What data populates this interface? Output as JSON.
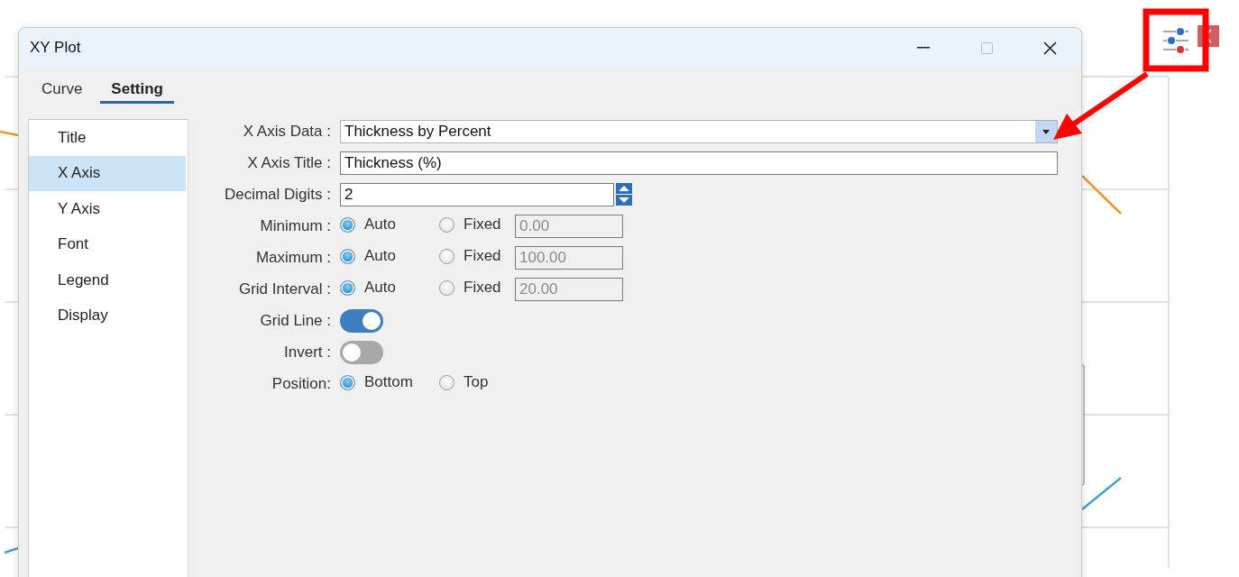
{
  "window": {
    "title": "XY Plot"
  },
  "tabs": [
    {
      "label": "Curve",
      "selected": false
    },
    {
      "label": "Setting",
      "selected": true
    }
  ],
  "sidebar": {
    "items": [
      {
        "label": "Title",
        "selected": false
      },
      {
        "label": "X Axis",
        "selected": true
      },
      {
        "label": "Y Axis",
        "selected": false
      },
      {
        "label": "Font",
        "selected": false
      },
      {
        "label": "Legend",
        "selected": false
      },
      {
        "label": "Display",
        "selected": false
      }
    ]
  },
  "form": {
    "rows": [
      {
        "kind": "dropdown",
        "label": "X Axis Data :",
        "value": "Thickness by Percent"
      },
      {
        "kind": "text",
        "label": "X Axis Title :",
        "value": "Thickness (%)"
      },
      {
        "kind": "spinner",
        "label": "Decimal Digits :",
        "value": "2"
      },
      {
        "kind": "range",
        "label": "Minimum :",
        "options": [
          {
            "label": "Auto",
            "selected": true
          },
          {
            "label": "Fixed",
            "selected": false
          }
        ],
        "value": "0.00",
        "disabled": true
      },
      {
        "kind": "range",
        "label": "Maximum :",
        "options": [
          {
            "label": "Auto",
            "selected": true
          },
          {
            "label": "Fixed",
            "selected": false
          }
        ],
        "value": "100.00",
        "disabled": true
      },
      {
        "kind": "range",
        "label": "Grid Interval :",
        "options": [
          {
            "label": "Auto",
            "selected": true
          },
          {
            "label": "Fixed",
            "selected": false
          }
        ],
        "value": "20.00",
        "disabled": true
      },
      {
        "kind": "toggle",
        "label": "Grid Line :",
        "on": true
      },
      {
        "kind": "toggle",
        "label": "Invert :",
        "on": false
      },
      {
        "kind": "radio",
        "label": "Position:",
        "options": [
          {
            "label": "Bottom",
            "selected": true
          },
          {
            "label": "Top",
            "selected": false
          }
        ]
      }
    ]
  }
}
